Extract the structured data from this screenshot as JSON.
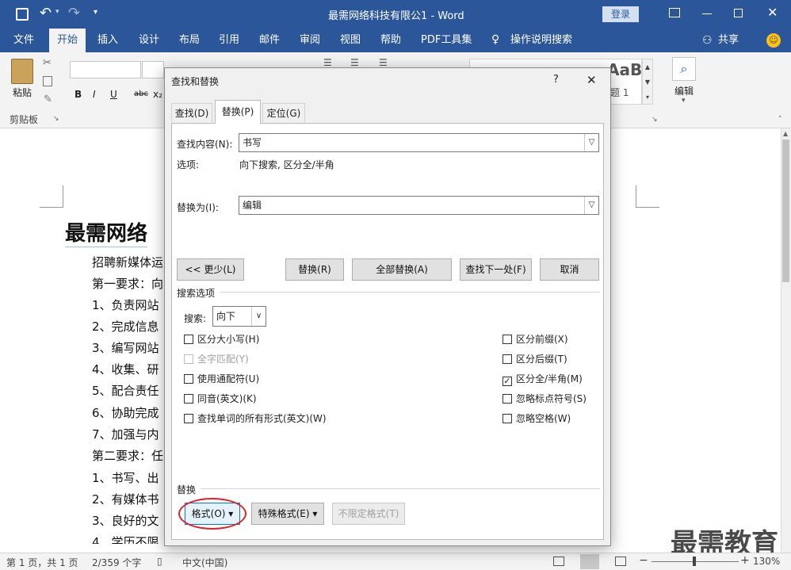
{
  "window": {
    "title": "最需网络科技有限公1 - Word",
    "login_label": "登录"
  },
  "menu": {
    "items": [
      "文件",
      "开始",
      "插入",
      "设计",
      "布局",
      "引用",
      "邮件",
      "审阅",
      "视图",
      "帮助",
      "PDF工具集"
    ],
    "active": "开始",
    "tell_me": "操作说明搜索",
    "share": "共享"
  },
  "ribbon": {
    "paste_label": "粘贴",
    "clipboard_label": "剪贴板",
    "font_buttons": [
      "B",
      "I",
      "U",
      "abc",
      "x₂"
    ],
    "style_preview": "AaBb",
    "style_name": "题 1",
    "edit_label": "编辑"
  },
  "document": {
    "heading": "最需网络",
    "lines": [
      "招聘新媒体运",
      "第一要求：向",
      "1、负责网站",
      "2、完成信息",
      "3、编写网站",
      "4、收集、研",
      "5、配合责任",
      "6、协助完成",
      "7、加强与内",
      "第二要求：任",
      "1、书写、出",
      "2、有媒体书",
      "3、良好的文",
      "4、学历不限"
    ]
  },
  "status": {
    "page": "第 1 页，共 1 页",
    "words": "2/359 个字",
    "language": "中文(中国)",
    "zoom": "130%"
  },
  "dialog": {
    "title": "查找和替换",
    "help": "?",
    "close": "✕",
    "tabs": [
      "查找(D)",
      "替换(P)",
      "定位(G)"
    ],
    "active_tab": "替换(P)",
    "find_label": "查找内容(N):",
    "find_value": "书写",
    "options_label": "选项:",
    "options_value": "向下搜索, 区分全/半角",
    "replace_label": "替换为(I):",
    "replace_value": "编辑",
    "buttons": {
      "less": "<< 更少(L)",
      "replace": "替换(R)",
      "replace_all": "全部替换(A)",
      "find_next": "查找下一处(F)",
      "cancel": "取消"
    },
    "search_options_label": "搜索选项",
    "search_label": "搜索:",
    "search_value": "向下",
    "left_checks": [
      {
        "label": "区分大小写(H)",
        "checked": false,
        "disabled": false
      },
      {
        "label": "全字匹配(Y)",
        "checked": false,
        "disabled": true
      },
      {
        "label": "使用通配符(U)",
        "checked": false,
        "disabled": false
      },
      {
        "label": "同音(英文)(K)",
        "checked": false,
        "disabled": false
      },
      {
        "label": "查找单词的所有形式(英文)(W)",
        "checked": false,
        "disabled": false
      }
    ],
    "right_checks": [
      {
        "label": "区分前缀(X)",
        "checked": false
      },
      {
        "label": "区分后缀(T)",
        "checked": false
      },
      {
        "label": "区分全/半角(M)",
        "checked": true
      },
      {
        "label": "忽略标点符号(S)",
        "checked": false
      },
      {
        "label": "忽略空格(W)",
        "checked": false
      }
    ],
    "replace_section_label": "替换",
    "format_button": "格式(O) ▾",
    "special_button": "特殊格式(E) ▾",
    "no_format_button": "不限定格式(T)",
    "highlight_color": "#e0202a"
  },
  "watermark": "最需教育"
}
